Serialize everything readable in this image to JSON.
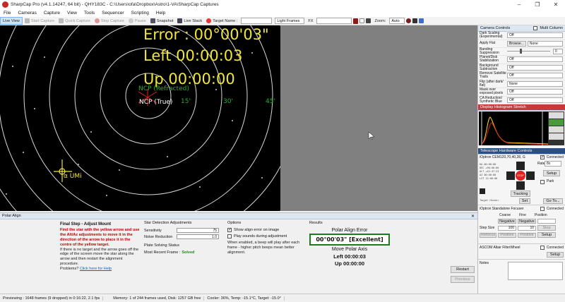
{
  "window": {
    "title": "SharpCap Pro (v4.1.14247, 64 bit)  -  QHY183C  -  C:\\Users\\ofa\\Dropbox\\Astro\\1-VA\\SharpCap Captures",
    "minimize": "–",
    "maximize": "❐",
    "close": "✕"
  },
  "menu": [
    "File",
    "Cameras",
    "Capture",
    "View",
    "Tools",
    "Sequencer",
    "Scripting",
    "Help"
  ],
  "toolbar": {
    "live_view": "Live View",
    "start_capture": "Start Capture",
    "quick_capture": "Quick Capture",
    "stop_capture": "Stop Capture",
    "pause": "Pause",
    "snapshot": "Snapshot",
    "live_stack": "Live Stack",
    "target_name_label": "Target Name :",
    "frame_type": "Light Frames",
    "fx_label": "FX",
    "zoom_label": "Zoom:",
    "zoom_value": "Auto"
  },
  "viewport": {
    "error_line": "Error : 00°00'03\"",
    "left_line": "Left 00:00:03",
    "up_line": "Up 00:00:00",
    "ncp_refracted": "NCP (Refracted)",
    "ncp_true": "NCP (True)",
    "ring_15": "15'",
    "ring_30": "30'",
    "ring_45": "45'",
    "star_name": "α UMi"
  },
  "camera_controls": {
    "header": "Camera Controls",
    "multi_column": "Multi Column",
    "rows": [
      {
        "label": "Dark Scaling (Experimental)",
        "value": "Off"
      },
      {
        "label": "Apply Flat",
        "value": "None",
        "button": "Browse..."
      },
      {
        "label": "Banding Suppression",
        "value": "0"
      },
      {
        "label": "Planet/Disk Stabilization",
        "value": "Off"
      },
      {
        "label": "Background Subtraction",
        "value": "Off"
      },
      {
        "label": "Remove Satellite Trails",
        "value": "Off"
      },
      {
        "label": "Flip (after dark/ flat)",
        "value": "None"
      },
      {
        "label": "Mask over exposed pixels",
        "value": "Off"
      },
      {
        "label": "CA Reduction/ Synthetic Blue",
        "value": "Off"
      }
    ]
  },
  "histogram": {
    "header": "Display Histogram Stretch"
  },
  "telescope": {
    "header": "Telescope Hardware Controls",
    "mount_name": "iOptron CEM120,70,40,28, G",
    "connected_label": "Connected",
    "rate_label": "Rate:",
    "rate_value": "8x",
    "setup": "Setup",
    "park": "Park",
    "tracking": "Tracking",
    "stop": "STOP",
    "set": "Set",
    "goto": "Go To...",
    "coords": [
      "RA 00:00:00",
      "DEC +90:00:00",
      "ALT +42:47:23",
      "AZ 00:00:00",
      "LST 12:00:00"
    ],
    "target": "Target: <None>",
    "focuser_name": "iOptron Standalone Focuser",
    "focuser_connected": "Connected",
    "coarse": "Coarse",
    "fine": "Fine",
    "position": "Position",
    "negative": "Negative",
    "positive": "Positive",
    "step_size_label": "Step Size",
    "step_coarse": "100",
    "step_fine": "10",
    "stop_btn": "Stop",
    "refocus": "Refocus",
    "filter_wheel": "ASCOM Altair FilterWheel",
    "filter_connected": "Connected",
    "notes_label": "Notes"
  },
  "polar_align": {
    "header": "Polar Align",
    "step_title": "Final Step - Adjust Mount",
    "instruction": "Find the star with the yellow arrow and use the Alt/Az adjustments to move it in the direction of the arrow to place it in the centre of the yellow target.",
    "note": "If there is no target and the arrow goes off the edge of the screen move the star along the arrow and then restart the alignment procedure.",
    "problems": "Problems?",
    "help_link": "Click here for Help",
    "star_detection_title": "Star Detection Adjustments",
    "sensitivity_label": "Sensitivity",
    "sensitivity_value": "75",
    "noise_label": "Noise Reduction",
    "noise_value": "1.0",
    "plate_title": "Plate Solving Status",
    "recent_frame_label": "Most Recent Frame :",
    "recent_frame_value": "Solved",
    "options_title": "Options",
    "opt_show_error": "Show align error on image",
    "opt_play_sounds": "Play sounds during adjustment",
    "opt_desc": "When enabled, a beep will play after each frame - higher pitch beeps mean better alignment.",
    "results_title": "Results",
    "polar_align_error_label": "Polar Align Error",
    "error_value": "00°00'03\" [Excellent]",
    "move_axis_label": "Move Polar Axis",
    "left_value": "Left 00:00:03",
    "up_value": "Up 00:00:00",
    "restart": "Restart",
    "previous": "Previous"
  },
  "status": {
    "preview": "Previewing : 1648 frames (9 dropped) in 0:16:22, 2.1 fps",
    "memory": "Memory: 1 of 244 frames used, Disk: 1257 GB free",
    "cooler": "Cooler: 36%, Temp: -15.1°C, Target: -15.0°"
  },
  "colors": {
    "overlay_yellow": "#f0e53a",
    "solved_green": "#1e8a1e",
    "instruction_red": "#c00000",
    "result_box_green": "#1e7a1e"
  }
}
